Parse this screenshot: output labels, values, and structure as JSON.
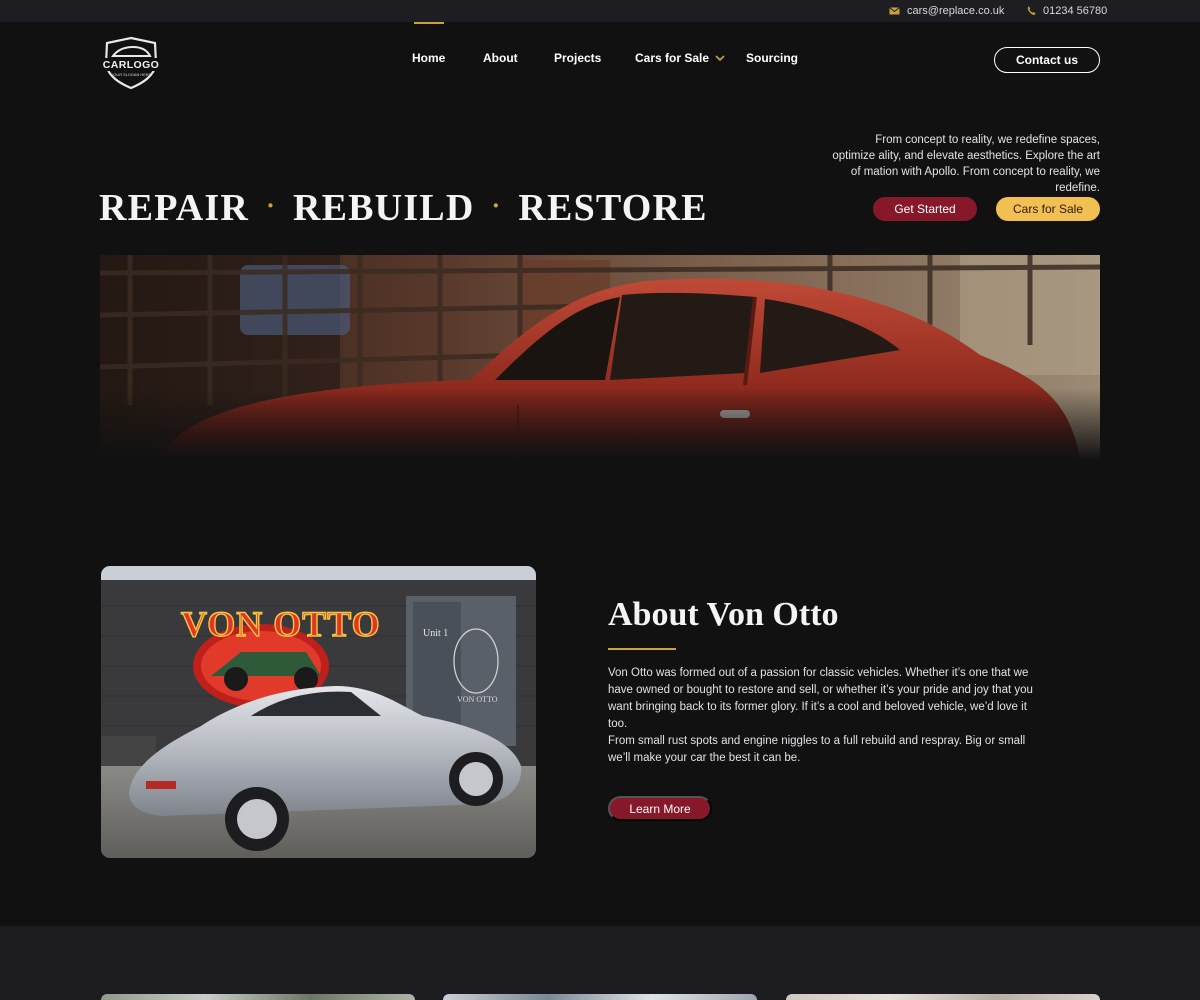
{
  "topbar": {
    "email": "cars@replace.co.uk",
    "phone": "01234 56780",
    "email_icon": "mail-icon",
    "phone_icon": "phone-icon"
  },
  "logo": {
    "name": "CARLOGO",
    "slogan": "YOUR SLOGAN HERE"
  },
  "nav": {
    "items": [
      {
        "label": "Home",
        "active": true
      },
      {
        "label": "About",
        "active": false
      },
      {
        "label": "Projects",
        "active": false
      },
      {
        "label": "Cars for Sale",
        "active": false,
        "dropdown": true
      },
      {
        "label": "Sourcing",
        "active": false
      }
    ],
    "contact_label": "Contact us"
  },
  "hero": {
    "intro": "From concept to reality, we redefine spaces, optimize ality, and elevate aesthetics. Explore the art of mation with Apollo. From concept to reality, we redefine.",
    "headline_words": [
      "REPAIR",
      "REBUILD",
      "RESTORE"
    ],
    "separator": "·",
    "primary_label": "Get Started",
    "secondary_label": "Cars for Sale"
  },
  "about": {
    "title": "About Von Otto",
    "paragraph1": "Von Otto was formed out of a passion for classic vehicles. Whether it’s one that we have owned or bought to restore and sell, or whether it’s your pride and joy that you want bringing back to its former glory. If it’s a cool and beloved vehicle, we’d love it too.",
    "paragraph2": "From small rust spots and engine niggles to a full rebuild and respray. Big or small we’ll make your car the best it can be.",
    "button_label": "Learn More",
    "mural_text": "VON OTTO",
    "door_text": "Unit 1",
    "door_sign": "VON OTTO"
  },
  "colors": {
    "background": "#111112",
    "topbar": "#1d1d22",
    "accent_gold": "#c9a23a",
    "primary_red": "#86182a",
    "secondary_yellow": "#f2bf52"
  }
}
